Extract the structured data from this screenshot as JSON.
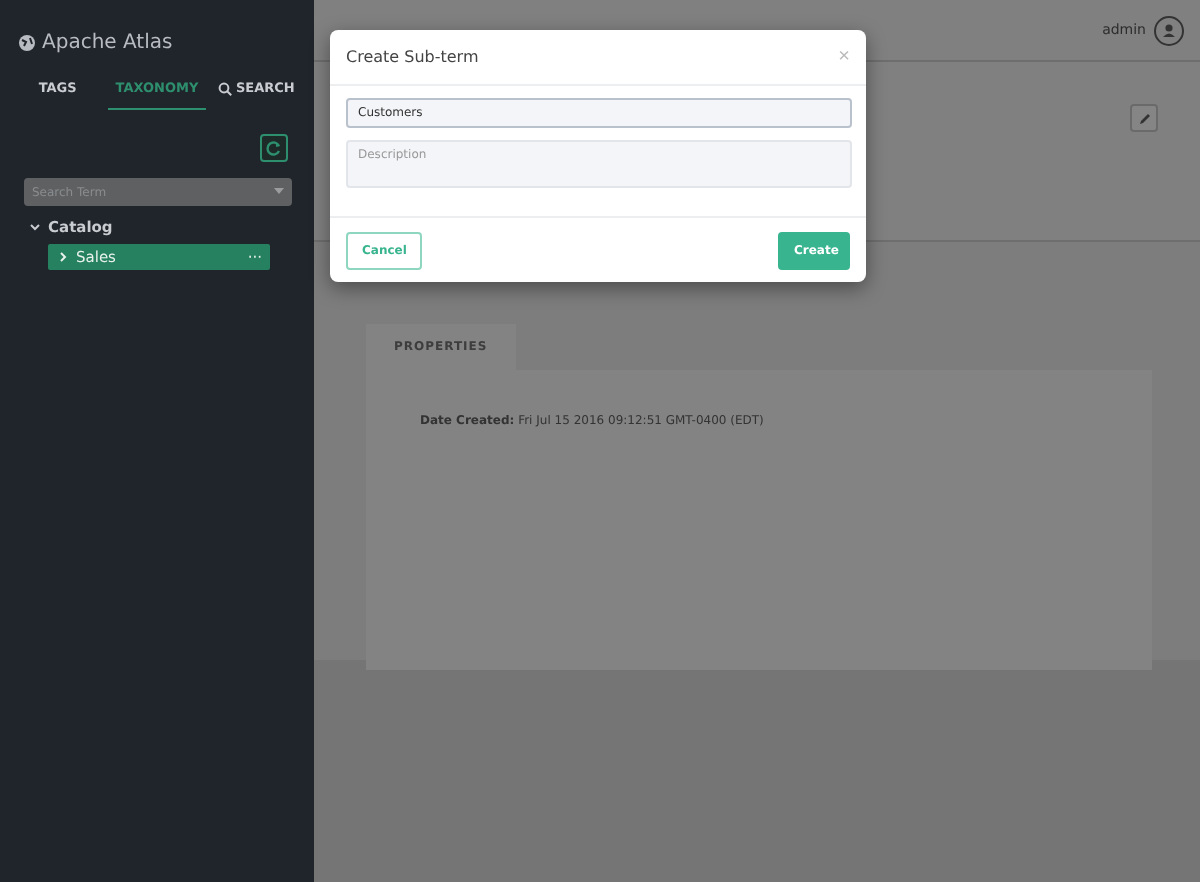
{
  "sidebar": {
    "title": "Apache Atlas",
    "tabs": [
      {
        "label": "TAGS",
        "selected": false
      },
      {
        "label": "TAXONOMY",
        "selected": true
      },
      {
        "label": "SEARCH",
        "selected": false
      }
    ],
    "search": {
      "placeholder": "Search Term"
    },
    "tree": [
      {
        "label": "Catalog",
        "expanded": true,
        "selected": false,
        "children": [
          {
            "label": "Sales",
            "expanded": false,
            "selected": true,
            "menu": "···"
          }
        ]
      }
    ]
  },
  "header": {
    "user": "admin"
  },
  "details": {
    "tabs": [
      {
        "label": "PROPERTIES"
      }
    ],
    "properties": [
      {
        "name": "Date Created:",
        "value": "Fri Jul 15 2016 09:12:51 GMT-0400 (EDT)"
      }
    ]
  },
  "modal": {
    "title": "Create Sub-term",
    "close": "×",
    "name_field": {
      "value": "Customers"
    },
    "description_field": {
      "placeholder": "Description"
    },
    "buttons": [
      {
        "label": "Cancel",
        "kind": "secondary"
      },
      {
        "label": "Create",
        "kind": "primary"
      }
    ]
  }
}
